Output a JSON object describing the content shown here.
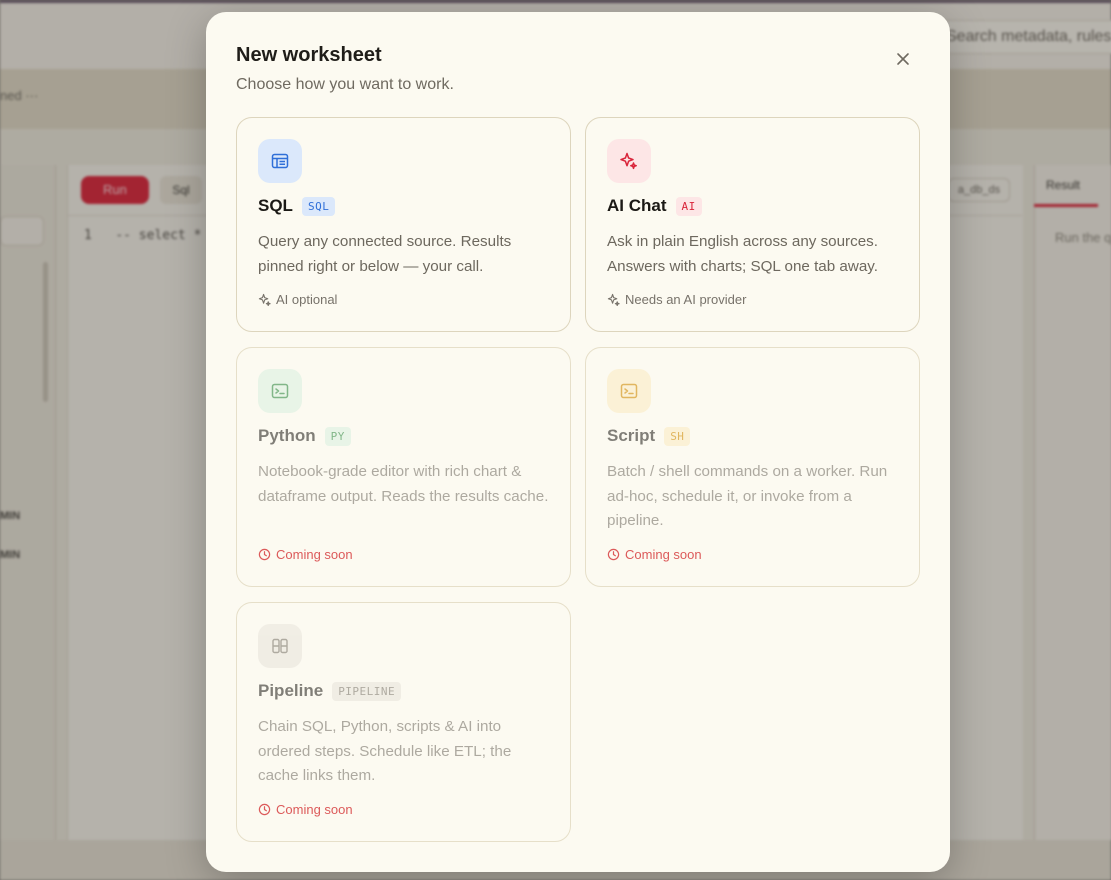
{
  "background": {
    "search_placeholder": "Search metadata, rules...",
    "subheader_text": "ned",
    "run_label": "Run",
    "toolbar_btn2": "Sql",
    "code_line_number": "1",
    "code_text": "-- select *",
    "sidebar_labels": [
      "MIN",
      "MIN"
    ],
    "right_tab": "Result",
    "right_hint": "Run the q",
    "tag_label": "a_db_ds"
  },
  "modal": {
    "title": "New worksheet",
    "subtitle": "Choose how you want to work.",
    "close_icon": "close-icon",
    "cards": [
      {
        "key": "sql",
        "title": "SQL",
        "badge": "SQL",
        "icon": "table-icon",
        "description": "Query any connected source. Results pinned right or below — your call.",
        "footer": "AI optional",
        "footer_icon": "sparkle-icon",
        "status": "available",
        "colors": {
          "icon_bg": "#dbe8fb",
          "icon_fg": "#2f6fd8",
          "badge_bg": "#dbe8fb",
          "badge_fg": "#2f6fd8"
        }
      },
      {
        "key": "ai-chat",
        "title": "AI Chat",
        "badge": "AI",
        "icon": "sparkles-icon",
        "description": "Ask in plain English across any sources. Answers with charts; SQL one tab away.",
        "footer": "Needs an AI provider",
        "footer_icon": "sparkle-icon",
        "status": "available",
        "colors": {
          "icon_bg": "#fde6e6",
          "icon_fg": "#d9243a",
          "badge_bg": "#fde6e6",
          "badge_fg": "#d9243a"
        }
      },
      {
        "key": "python",
        "title": "Python",
        "badge": "PY",
        "icon": "terminal-icon",
        "description": "Notebook-grade editor with rich chart & dataframe output. Reads the results cache.",
        "footer": "Coming soon",
        "footer_icon": "clock-icon",
        "status": "coming-soon",
        "colors": {
          "icon_bg": "#e0f2e3",
          "icon_fg": "#4e9a5d",
          "badge_bg": "#e0f2e3",
          "badge_fg": "#4e9a5d"
        }
      },
      {
        "key": "script",
        "title": "Script",
        "badge": "SH",
        "icon": "terminal-icon",
        "description": "Batch / shell commands on a worker. Run ad-hoc, schedule it, or invoke from a pipeline.",
        "footer": "Coming soon",
        "footer_icon": "clock-icon",
        "status": "coming-soon",
        "colors": {
          "icon_bg": "#fbeecb",
          "icon_fg": "#d69a22",
          "badge_bg": "#fbeecb",
          "badge_fg": "#d69a22"
        }
      },
      {
        "key": "pipeline",
        "title": "Pipeline",
        "badge": "PIPELINE",
        "icon": "pipeline-icon",
        "description": "Chain SQL, Python, scripts & AI into ordered steps. Schedule like ETL; the cache links them.",
        "footer": "Coming soon",
        "footer_icon": "clock-icon",
        "status": "coming-soon",
        "colors": {
          "icon_bg": "#ece8df",
          "icon_fg": "#8e897f",
          "badge_bg": "#ece8df",
          "badge_fg": "#8e897f"
        }
      }
    ]
  }
}
